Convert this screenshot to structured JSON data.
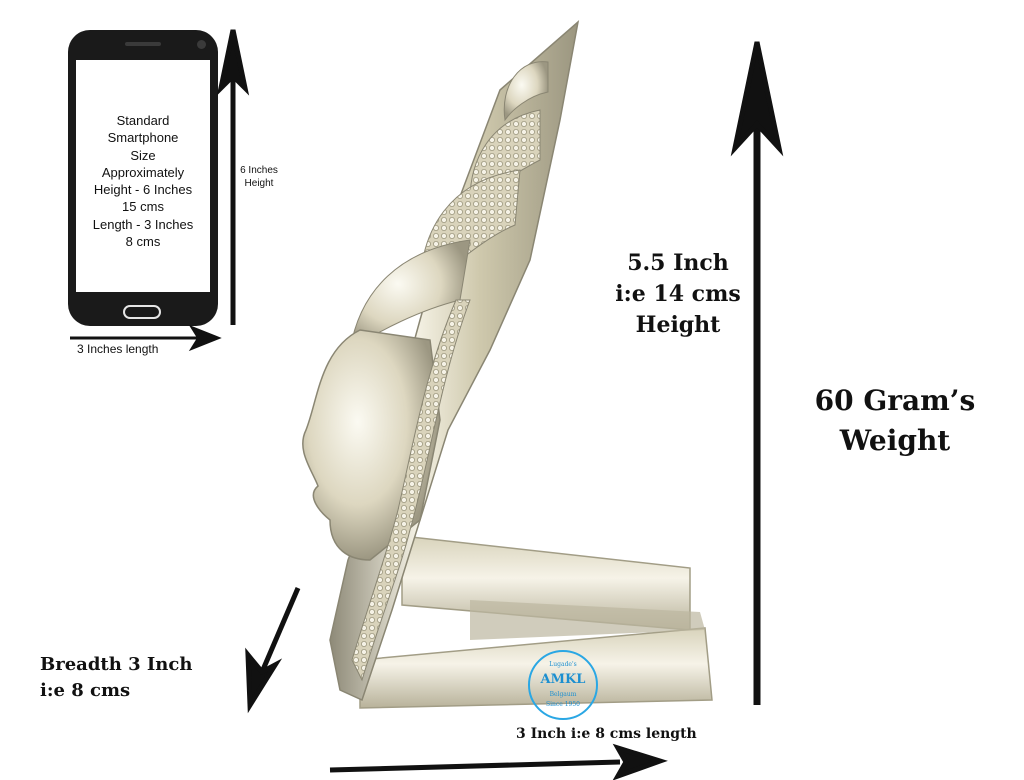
{
  "phone": {
    "lines": [
      "Standard",
      "Smartphone",
      "Size",
      "Approximately",
      "Height - 6 Inches",
      "15 cms",
      "Length - 3 Inches",
      "8 cms"
    ],
    "height_label": [
      "6 Inches",
      "Height"
    ],
    "width_label": "3 Inches length"
  },
  "product": {
    "height_label": [
      "5.5 Inch",
      "i:e 14 cms",
      "Height"
    ],
    "weight_label": [
      "60 Gram’s",
      "Weight"
    ],
    "breadth_label": [
      "Breadth 3 Inch",
      "i:e 8 cms"
    ],
    "length_label": "3 Inch i:e 8 cms length"
  },
  "logo": {
    "top": "Lugade's",
    "name": "AMKL",
    "city": "Belgaum",
    "since": "Since 1950"
  },
  "colors": {
    "arrow": "#111111",
    "silver_light": "#f4f1e4",
    "silver_mid": "#cfc9ad",
    "silver_dark": "#8e8a78",
    "logo_blue": "#2aa7e4"
  }
}
